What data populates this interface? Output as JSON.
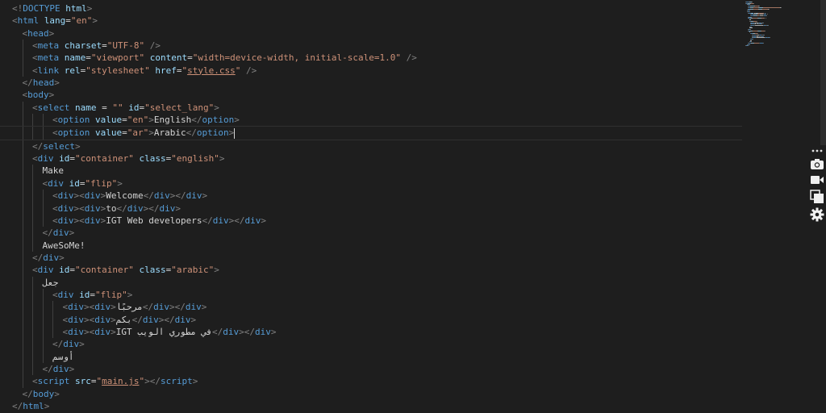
{
  "code": {
    "lines": [
      {
        "indent": 0,
        "tokens": [
          [
            "t",
            "<!"
          ],
          [
            "tag",
            "DOCTYPE"
          ],
          [
            "txt",
            " "
          ],
          [
            "attr",
            "html"
          ],
          [
            "t",
            ">"
          ]
        ]
      },
      {
        "indent": 0,
        "tokens": [
          [
            "t",
            "<"
          ],
          [
            "tag",
            "html"
          ],
          [
            "txt",
            " "
          ],
          [
            "attr",
            "lang"
          ],
          [
            "txt",
            "="
          ],
          [
            "str",
            "\"en\""
          ],
          [
            "t",
            ">"
          ]
        ]
      },
      {
        "indent": 1,
        "tokens": [
          [
            "t",
            "<"
          ],
          [
            "tag",
            "head"
          ],
          [
            "t",
            ">"
          ]
        ]
      },
      {
        "indent": 2,
        "tokens": [
          [
            "t",
            "<"
          ],
          [
            "tag",
            "meta"
          ],
          [
            "txt",
            " "
          ],
          [
            "attr",
            "charset"
          ],
          [
            "txt",
            "="
          ],
          [
            "str",
            "\"UTF-8\""
          ],
          [
            "txt",
            " "
          ],
          [
            "t",
            "/>"
          ]
        ]
      },
      {
        "indent": 2,
        "tokens": [
          [
            "t",
            "<"
          ],
          [
            "tag",
            "meta"
          ],
          [
            "txt",
            " "
          ],
          [
            "attr",
            "name"
          ],
          [
            "txt",
            "="
          ],
          [
            "str",
            "\"viewport\""
          ],
          [
            "txt",
            " "
          ],
          [
            "attr",
            "content"
          ],
          [
            "txt",
            "="
          ],
          [
            "str",
            "\"width=device-width, initial-scale=1.0\""
          ],
          [
            "txt",
            " "
          ],
          [
            "t",
            "/>"
          ]
        ]
      },
      {
        "indent": 2,
        "tokens": [
          [
            "t",
            "<"
          ],
          [
            "tag",
            "link"
          ],
          [
            "txt",
            " "
          ],
          [
            "attr",
            "rel"
          ],
          [
            "txt",
            "="
          ],
          [
            "str",
            "\"stylesheet\""
          ],
          [
            "txt",
            " "
          ],
          [
            "attr",
            "href"
          ],
          [
            "txt",
            "="
          ],
          [
            "str",
            "\""
          ],
          [
            "strlink",
            "style.css"
          ],
          [
            "str",
            "\""
          ],
          [
            "txt",
            " "
          ],
          [
            "t",
            "/>"
          ]
        ]
      },
      {
        "indent": 1,
        "tokens": [
          [
            "t",
            "</"
          ],
          [
            "tag",
            "head"
          ],
          [
            "t",
            ">"
          ]
        ]
      },
      {
        "indent": 1,
        "tokens": [
          [
            "t",
            "<"
          ],
          [
            "tag",
            "body"
          ],
          [
            "t",
            ">"
          ]
        ]
      },
      {
        "indent": 2,
        "tokens": [
          [
            "t",
            "<"
          ],
          [
            "tag",
            "select"
          ],
          [
            "txt",
            " "
          ],
          [
            "attr",
            "name"
          ],
          [
            "txt",
            " = "
          ],
          [
            "str",
            "\"\""
          ],
          [
            "txt",
            " "
          ],
          [
            "attr",
            "id"
          ],
          [
            "txt",
            "="
          ],
          [
            "str",
            "\"select_lang\""
          ],
          [
            "t",
            ">"
          ]
        ]
      },
      {
        "indent": 4,
        "tokens": [
          [
            "t",
            "<"
          ],
          [
            "tag",
            "option"
          ],
          [
            "txt",
            " "
          ],
          [
            "attr",
            "value"
          ],
          [
            "txt",
            "="
          ],
          [
            "str",
            "\"en\""
          ],
          [
            "t",
            ">"
          ],
          [
            "txt",
            "English"
          ],
          [
            "t",
            "</"
          ],
          [
            "tag",
            "option"
          ],
          [
            "t",
            ">"
          ]
        ]
      },
      {
        "indent": 4,
        "tokens": [
          [
            "t",
            "<"
          ],
          [
            "tag",
            "option"
          ],
          [
            "txt",
            " "
          ],
          [
            "attr",
            "value"
          ],
          [
            "txt",
            "="
          ],
          [
            "str",
            "\"ar\""
          ],
          [
            "t",
            ">"
          ],
          [
            "txt",
            "Arabic"
          ],
          [
            "t",
            "</"
          ],
          [
            "tag",
            "option"
          ],
          [
            "t",
            ">"
          ],
          [
            "caret",
            ""
          ]
        ],
        "current": true
      },
      {
        "indent": 2,
        "tokens": [
          [
            "t",
            "</"
          ],
          [
            "tag",
            "select"
          ],
          [
            "t",
            ">"
          ]
        ]
      },
      {
        "indent": 2,
        "tokens": [
          [
            "t",
            "<"
          ],
          [
            "tag",
            "div"
          ],
          [
            "txt",
            " "
          ],
          [
            "attr",
            "id"
          ],
          [
            "txt",
            "="
          ],
          [
            "str",
            "\"container\""
          ],
          [
            "txt",
            " "
          ],
          [
            "attr",
            "class"
          ],
          [
            "txt",
            "="
          ],
          [
            "str",
            "\"english\""
          ],
          [
            "t",
            ">"
          ]
        ]
      },
      {
        "indent": 3,
        "tokens": [
          [
            "txt",
            "Make"
          ]
        ]
      },
      {
        "indent": 3,
        "tokens": [
          [
            "t",
            "<"
          ],
          [
            "tag",
            "div"
          ],
          [
            "txt",
            " "
          ],
          [
            "attr",
            "id"
          ],
          [
            "txt",
            "="
          ],
          [
            "str",
            "\"flip\""
          ],
          [
            "t",
            ">"
          ]
        ]
      },
      {
        "indent": 4,
        "tokens": [
          [
            "t",
            "<"
          ],
          [
            "tag",
            "div"
          ],
          [
            "t",
            "><"
          ],
          [
            "tag",
            "div"
          ],
          [
            "t",
            ">"
          ],
          [
            "txt",
            "Welcome"
          ],
          [
            "t",
            "</"
          ],
          [
            "tag",
            "div"
          ],
          [
            "t",
            "></"
          ],
          [
            "tag",
            "div"
          ],
          [
            "t",
            ">"
          ]
        ]
      },
      {
        "indent": 4,
        "tokens": [
          [
            "t",
            "<"
          ],
          [
            "tag",
            "div"
          ],
          [
            "t",
            "><"
          ],
          [
            "tag",
            "div"
          ],
          [
            "t",
            ">"
          ],
          [
            "txt",
            "to"
          ],
          [
            "t",
            "</"
          ],
          [
            "tag",
            "div"
          ],
          [
            "t",
            "></"
          ],
          [
            "tag",
            "div"
          ],
          [
            "t",
            ">"
          ]
        ]
      },
      {
        "indent": 4,
        "tokens": [
          [
            "t",
            "<"
          ],
          [
            "tag",
            "div"
          ],
          [
            "t",
            "><"
          ],
          [
            "tag",
            "div"
          ],
          [
            "t",
            ">"
          ],
          [
            "txt",
            "IGT Web developers"
          ],
          [
            "t",
            "</"
          ],
          [
            "tag",
            "div"
          ],
          [
            "t",
            "></"
          ],
          [
            "tag",
            "div"
          ],
          [
            "t",
            ">"
          ]
        ]
      },
      {
        "indent": 3,
        "tokens": [
          [
            "t",
            "</"
          ],
          [
            "tag",
            "div"
          ],
          [
            "t",
            ">"
          ]
        ]
      },
      {
        "indent": 3,
        "tokens": [
          [
            "txt",
            "AweSoMe!"
          ]
        ]
      },
      {
        "indent": 2,
        "tokens": [
          [
            "t",
            "</"
          ],
          [
            "tag",
            "div"
          ],
          [
            "t",
            ">"
          ]
        ]
      },
      {
        "indent": 2,
        "tokens": [
          [
            "t",
            "<"
          ],
          [
            "tag",
            "div"
          ],
          [
            "txt",
            " "
          ],
          [
            "attr",
            "id"
          ],
          [
            "txt",
            "="
          ],
          [
            "str",
            "\"container\""
          ],
          [
            "txt",
            " "
          ],
          [
            "attr",
            "class"
          ],
          [
            "txt",
            "="
          ],
          [
            "str",
            "\"arabic\""
          ],
          [
            "t",
            ">"
          ]
        ]
      },
      {
        "indent": 3,
        "tokens": [
          [
            "txt",
            "جعل"
          ]
        ]
      },
      {
        "indent": 4,
        "tokens": [
          [
            "t",
            "<"
          ],
          [
            "tag",
            "div"
          ],
          [
            "txt",
            " "
          ],
          [
            "attr",
            "id"
          ],
          [
            "txt",
            "="
          ],
          [
            "str",
            "\"flip\""
          ],
          [
            "t",
            ">"
          ]
        ]
      },
      {
        "indent": 5,
        "tokens": [
          [
            "t",
            "<"
          ],
          [
            "tag",
            "div"
          ],
          [
            "t",
            "><"
          ],
          [
            "tag",
            "div"
          ],
          [
            "t",
            ">"
          ],
          [
            "txt",
            "مرحبًا"
          ],
          [
            "t",
            "</"
          ],
          [
            "tag",
            "div"
          ],
          [
            "t",
            "></"
          ],
          [
            "tag",
            "div"
          ],
          [
            "t",
            ">"
          ]
        ]
      },
      {
        "indent": 5,
        "tokens": [
          [
            "t",
            "<"
          ],
          [
            "tag",
            "div"
          ],
          [
            "t",
            "><"
          ],
          [
            "tag",
            "div"
          ],
          [
            "t",
            ">"
          ],
          [
            "txt",
            "بكم"
          ],
          [
            "t",
            "</"
          ],
          [
            "tag",
            "div"
          ],
          [
            "t",
            "></"
          ],
          [
            "tag",
            "div"
          ],
          [
            "t",
            ">"
          ]
        ]
      },
      {
        "indent": 5,
        "tokens": [
          [
            "t",
            "<"
          ],
          [
            "tag",
            "div"
          ],
          [
            "t",
            "><"
          ],
          [
            "tag",
            "div"
          ],
          [
            "t",
            ">"
          ],
          [
            "txt",
            "IGT في مطوري الويب"
          ],
          [
            "t",
            "</"
          ],
          [
            "tag",
            "div"
          ],
          [
            "t",
            "></"
          ],
          [
            "tag",
            "div"
          ],
          [
            "t",
            ">"
          ]
        ]
      },
      {
        "indent": 4,
        "tokens": [
          [
            "t",
            "</"
          ],
          [
            "tag",
            "div"
          ],
          [
            "t",
            ">"
          ]
        ]
      },
      {
        "indent": 4,
        "tokens": [
          [
            "txt",
            "أوسم"
          ]
        ]
      },
      {
        "indent": 3,
        "tokens": [
          [
            "t",
            "</"
          ],
          [
            "tag",
            "div"
          ],
          [
            "t",
            ">"
          ]
        ]
      },
      {
        "indent": 2,
        "tokens": [
          [
            "t",
            "<"
          ],
          [
            "tag",
            "script"
          ],
          [
            "txt",
            " "
          ],
          [
            "attr",
            "src"
          ],
          [
            "txt",
            "="
          ],
          [
            "str",
            "\""
          ],
          [
            "strlink",
            "main.js"
          ],
          [
            "str",
            "\""
          ],
          [
            "t",
            "></"
          ],
          [
            "tag",
            "script"
          ],
          [
            "t",
            ">"
          ]
        ]
      },
      {
        "indent": 1,
        "tokens": [
          [
            "t",
            "</"
          ],
          [
            "tag",
            "body"
          ],
          [
            "t",
            ">"
          ]
        ]
      },
      {
        "indent": 0,
        "tokens": [
          [
            "t",
            "</"
          ],
          [
            "tag",
            "html"
          ],
          [
            "t",
            ">"
          ]
        ]
      }
    ]
  },
  "toolbar": {
    "icons": [
      "more-icon",
      "camera-icon",
      "video-icon",
      "copy-icon",
      "gear-icon"
    ]
  },
  "colors": {
    "background": "#1e1e1e",
    "tag": "#569cd6",
    "attribute": "#9cdcfe",
    "string": "#ce9178",
    "punctuation": "#808080",
    "text": "#d4d4d4"
  }
}
